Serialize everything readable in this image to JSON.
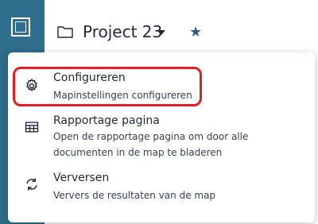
{
  "header": {
    "project_title": "Project 23",
    "star_icon": "star-icon",
    "folder_icon": "folder-icon"
  },
  "menu": {
    "items": [
      {
        "title": "Configureren",
        "desc": "Mapinstellingen configureren",
        "icon": "gear-icon"
      },
      {
        "title": "Rapportage pagina",
        "desc": "Open de rapportage pagina om door alle documenten in de map te bladeren",
        "icon": "table-icon"
      },
      {
        "title": "Verversen",
        "desc": "Ververs de resultaten van de map",
        "icon": "refresh-icon"
      }
    ]
  },
  "colors": {
    "rail": "#2f6e8c",
    "highlight": "#e11d2a",
    "accent": "#2c5f86"
  }
}
